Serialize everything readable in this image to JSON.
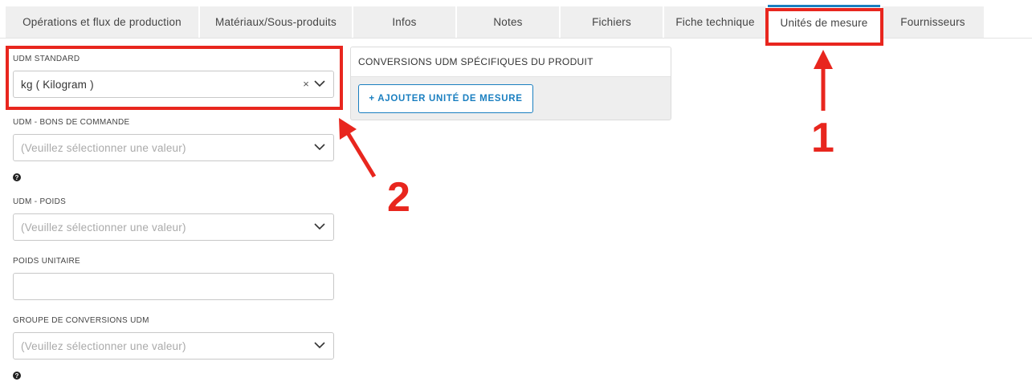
{
  "tabs": [
    {
      "label": "Opérations et flux de production",
      "active": false
    },
    {
      "label": "Matériaux/Sous-produits",
      "active": false
    },
    {
      "label": "Infos",
      "active": false
    },
    {
      "label": "Notes",
      "active": false
    },
    {
      "label": "Fichiers",
      "active": false
    },
    {
      "label": "Fiche technique",
      "active": false
    },
    {
      "label": "Unités de mesure",
      "active": true
    },
    {
      "label": "Fournisseurs",
      "active": false
    }
  ],
  "form": {
    "udm_standard": {
      "label": "UDM STANDARD",
      "value": "kg ( Kilogram )"
    },
    "udm_bons": {
      "label": "UDM - BONS DE COMMANDE",
      "placeholder": "(Veuillez sélectionner une valeur)"
    },
    "udm_poids": {
      "label": "UDM - POIDS",
      "placeholder": "(Veuillez sélectionner une valeur)"
    },
    "poids_unitaire": {
      "label": "POIDS UNITAIRE",
      "value": ""
    },
    "groupe_conversions": {
      "label": "GROUPE DE CONVERSIONS UDM",
      "placeholder": "(Veuillez sélectionner une valeur)"
    },
    "help_glyph": "?",
    "clear_glyph": "×"
  },
  "conversions_panel": {
    "title": "CONVERSIONS UDM SPÉCIFIQUES DU PRODUIT",
    "add_button": "+ AJOUTER UNITÉ DE MESURE"
  },
  "annotations": {
    "marker_1": "1",
    "marker_2": "2",
    "color": "#e8261e"
  },
  "colors": {
    "accent": "#1a7fc0",
    "tab_bg": "#efefef"
  }
}
